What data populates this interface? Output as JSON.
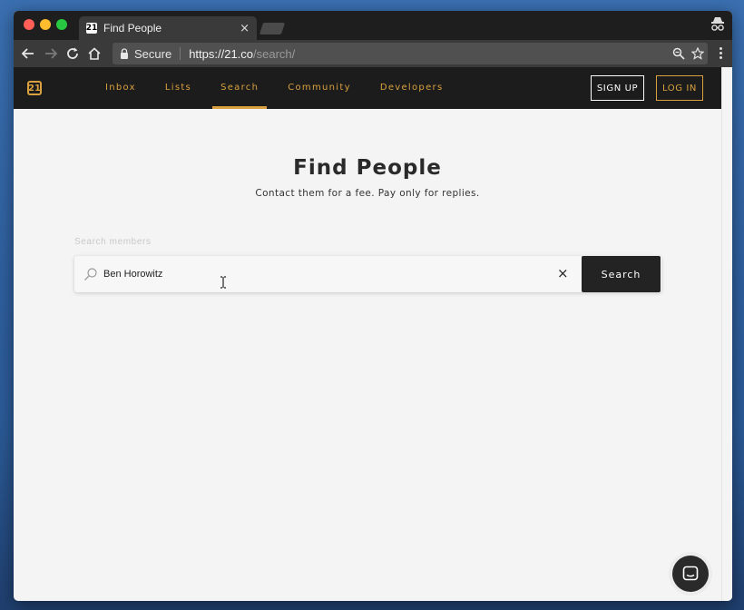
{
  "browser": {
    "tab_title": "Find People",
    "tab_favicon": "21",
    "tab_close": "×",
    "secure_label": "Secure",
    "url_host": "https://21.co",
    "url_path": "/search/"
  },
  "site": {
    "logo": "21",
    "nav": [
      "Inbox",
      "Lists",
      "Search",
      "Community",
      "Developers"
    ],
    "active_nav": "Search",
    "signup_label": "SIGN UP",
    "login_label": "LOG IN",
    "accent_color": "#d9a13f"
  },
  "main": {
    "title": "Find People",
    "subtitle": "Contact them for a fee. Pay only for replies.",
    "search_label": "Search members",
    "search_value": "Ben Horowitz",
    "clear_label": "×",
    "search_button": "Search"
  }
}
